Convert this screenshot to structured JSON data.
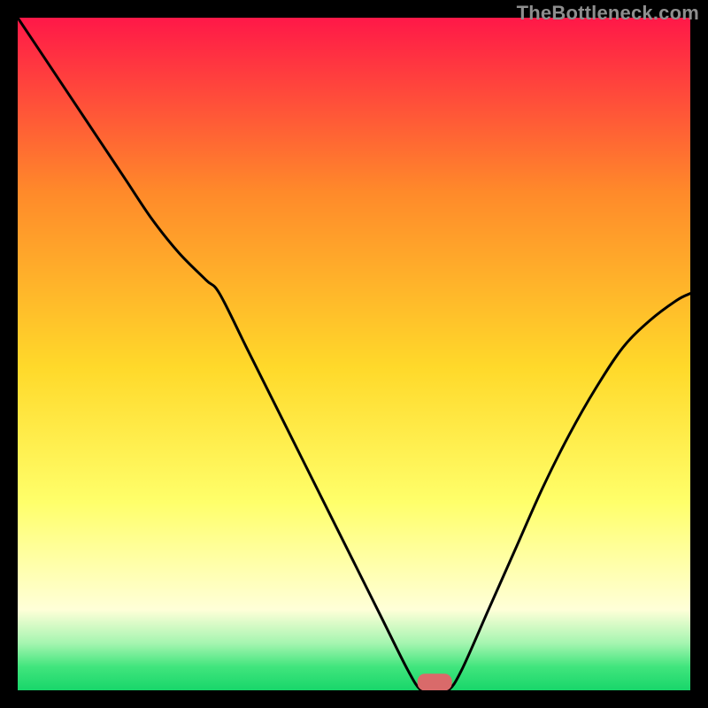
{
  "watermark": "TheBottleneck.com",
  "colors": {
    "top": "#ff1848",
    "mid_upper": "#ff8a2a",
    "mid": "#ffd92a",
    "mid_lower": "#ffff6a",
    "pale": "#ffffd8",
    "green1": "#a5f5b0",
    "green2": "#41e57d",
    "green3": "#18d66a",
    "curve": "#000000",
    "marker_fill": "#d96a6a",
    "marker_stroke": "#d96a6a",
    "marker_dash": "#bfe874"
  },
  "chart_data": {
    "type": "line",
    "title": "",
    "xlabel": "",
    "ylabel": "",
    "xlim": [
      0,
      100
    ],
    "ylim": [
      0,
      100
    ],
    "x": [
      0,
      4,
      8,
      12,
      16,
      20,
      24,
      28,
      30,
      34,
      38,
      42,
      46,
      50,
      54,
      58,
      60,
      62,
      64,
      66,
      70,
      74,
      78,
      82,
      86,
      90,
      94,
      98,
      100
    ],
    "values": [
      100,
      94,
      88,
      82,
      76,
      70,
      65,
      61,
      59,
      51,
      43,
      35,
      27,
      19,
      11,
      3,
      0,
      0,
      0,
      3,
      12,
      21,
      30,
      38,
      45,
      51,
      55,
      58,
      59
    ],
    "marker": {
      "x": 62,
      "y": 1.2,
      "w": 5,
      "h": 2.4
    },
    "annotations": []
  }
}
